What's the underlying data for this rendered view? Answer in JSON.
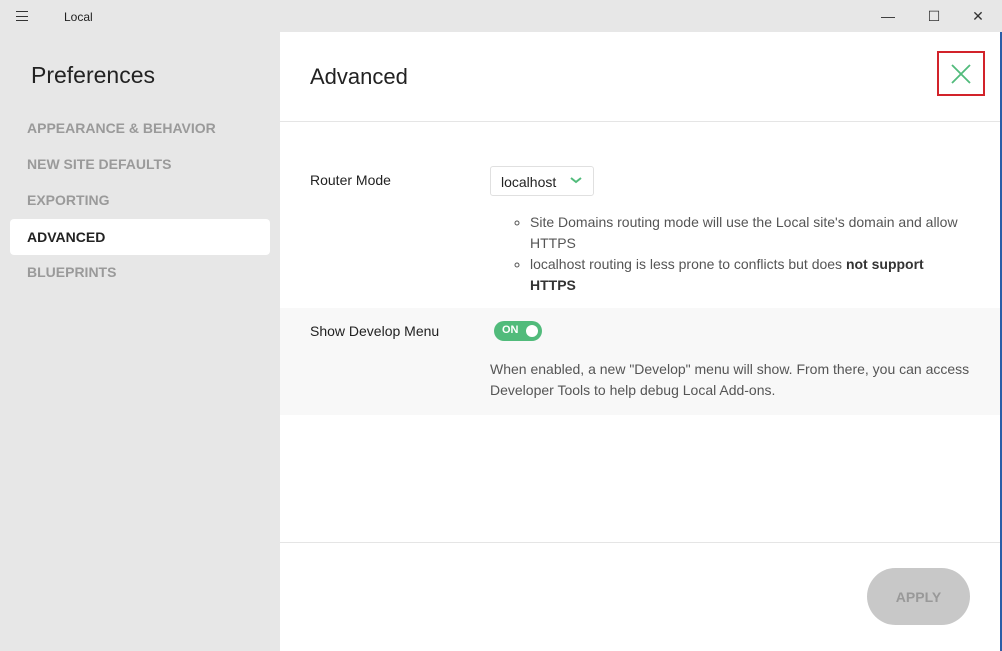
{
  "window": {
    "title": "Local",
    "minimize": "—",
    "maximize": "☐",
    "close": "✕"
  },
  "sidebar": {
    "title": "Preferences",
    "items": [
      {
        "label": "APPEARANCE & BEHAVIOR"
      },
      {
        "label": "NEW SITE DEFAULTS"
      },
      {
        "label": "EXPORTING"
      },
      {
        "label": "ADVANCED",
        "active": true
      },
      {
        "label": "BLUEPRINTS"
      }
    ]
  },
  "main": {
    "title": "Advanced",
    "router": {
      "label": "Router Mode",
      "value": "localhost",
      "notes": [
        "Site Domains routing mode will use the Local site's domain and allow HTTPS",
        "localhost routing is less prone to conflicts but does "
      ],
      "note2_bold": "not support HTTPS"
    },
    "develop": {
      "label": "Show Develop Menu",
      "toggle": "ON",
      "enabled": true,
      "description": "When enabled, a new \"Develop\" menu will show. From there, you can access Developer Tools to help debug Local Add-ons."
    },
    "apply_label": "APPLY"
  },
  "colors": {
    "accent": "#51bb7b",
    "highlight": "#d2232a"
  }
}
